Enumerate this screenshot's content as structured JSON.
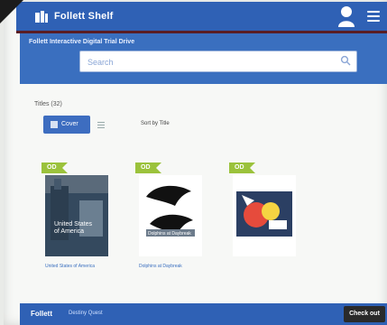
{
  "header": {
    "brand": "Follett Shelf",
    "icons": [
      "book-logo-icon",
      "user-icon",
      "hamburger-menu-icon"
    ]
  },
  "search": {
    "collection": "Follett Interactive Digital Trial Drive",
    "placeholder": "Search"
  },
  "filters": {
    "label": "Titles (32)",
    "cover_button": "Cover",
    "sort_label": "Sort by Title",
    "sort_value": "",
    "page_info": ""
  },
  "titles": [
    {
      "badge": "OD",
      "title": "United States of America",
      "subtitle": ""
    },
    {
      "badge": "OD",
      "title": "Dolphins at Daybreak",
      "subtitle": ""
    },
    {
      "badge": "OD",
      "title": "",
      "subtitle": ""
    }
  ],
  "footer": {
    "brand": "Follett",
    "sub": "Destiny Quest",
    "checkout": "Check out"
  },
  "colors": {
    "primary": "#2f61b5",
    "band": "#3a6fbf",
    "badge": "#9bc23b",
    "accent_divider": "#5a1d24"
  }
}
